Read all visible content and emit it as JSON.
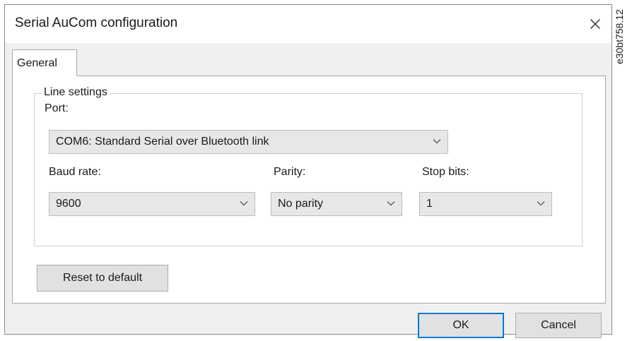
{
  "dialog": {
    "title": "Serial AuCom configuration",
    "close_glyph": "✕"
  },
  "tabs": [
    {
      "label": "General",
      "selected": true
    }
  ],
  "line_settings": {
    "legend": "Line settings",
    "port": {
      "label": "Port:",
      "value": "COM6: Standard Serial over Bluetooth link"
    },
    "baud_rate": {
      "label": "Baud rate:",
      "value": "9600"
    },
    "parity": {
      "label": "Parity:",
      "value": "No parity"
    },
    "stop_bits": {
      "label": "Stop bits:",
      "value": "1"
    }
  },
  "buttons": {
    "reset": "Reset to default",
    "ok": "OK",
    "cancel": "Cancel"
  },
  "watermark": "e30bt758.12",
  "colors": {
    "focus_border": "#0078d7",
    "dialog_bg": "#f0f0f0"
  }
}
